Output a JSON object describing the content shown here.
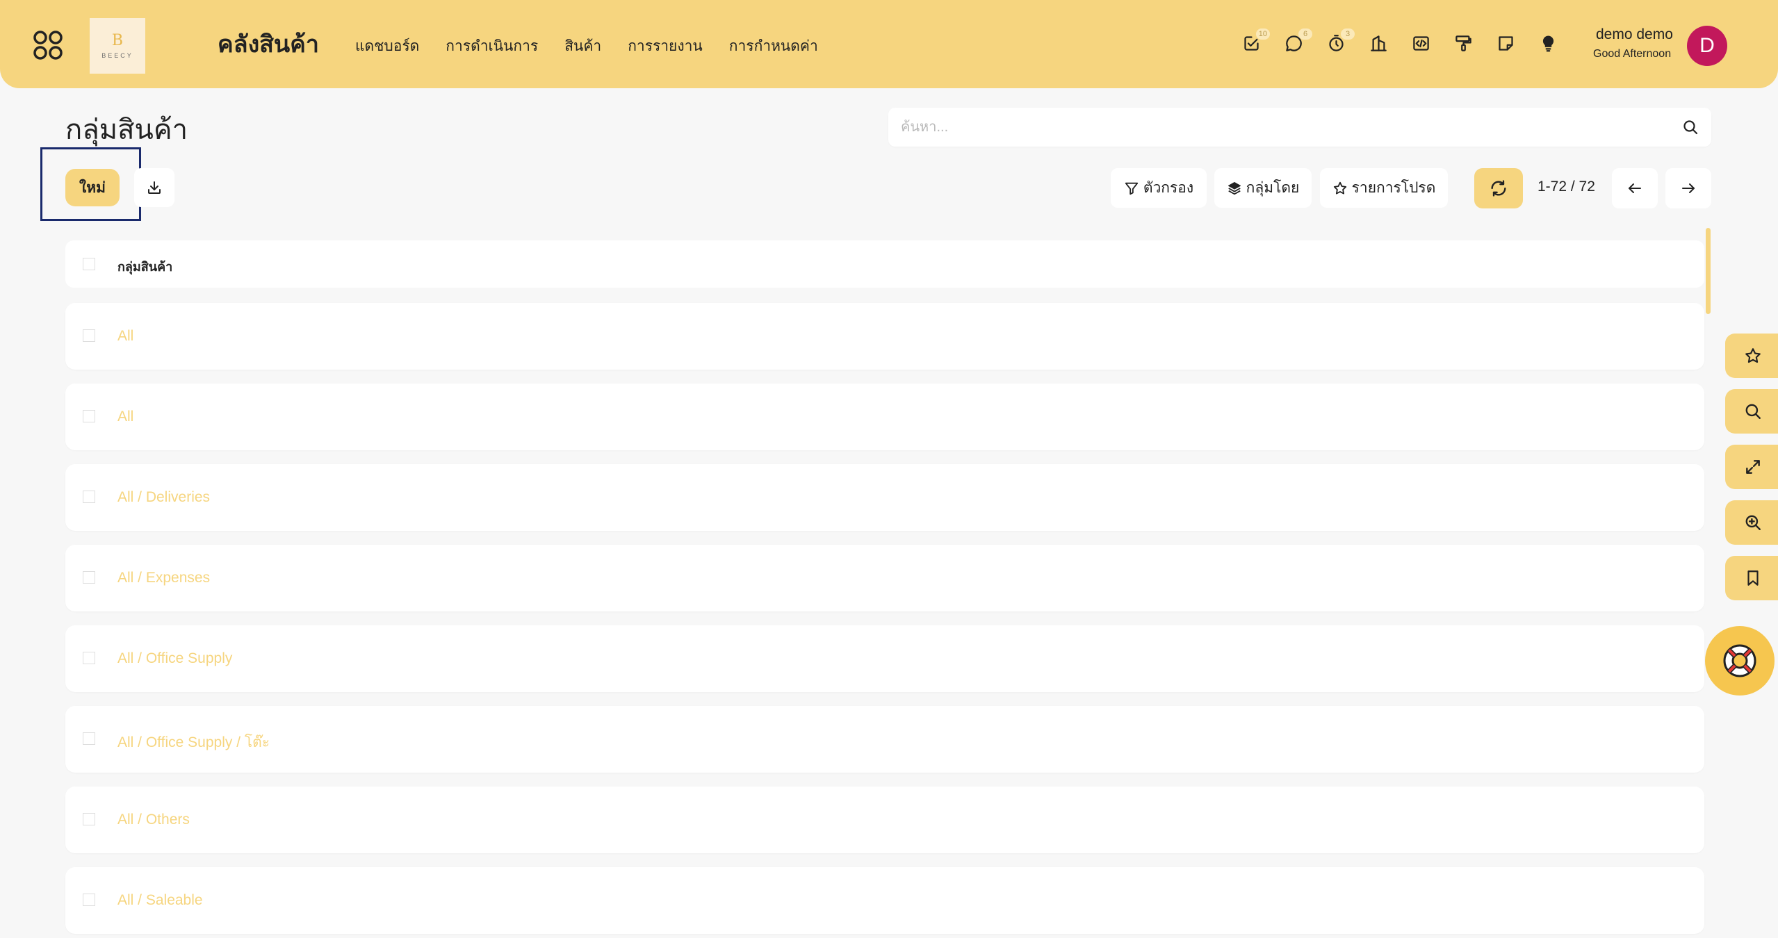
{
  "app": {
    "title": "คลังสินค้า",
    "logo_text": "BEECY",
    "logo_letter": "B"
  },
  "nav": {
    "items": [
      "แดชบอร์ด",
      "การดำเนินการ",
      "สินค้า",
      "การรายงาน",
      "การกำหนดค่า"
    ]
  },
  "top_icons": [
    {
      "icon": "activity-icon",
      "badge": "10"
    },
    {
      "icon": "chat-icon",
      "badge": "6"
    },
    {
      "icon": "timer-icon",
      "badge": "3"
    },
    {
      "icon": "building-icon",
      "badge": ""
    },
    {
      "icon": "code-icon",
      "badge": ""
    },
    {
      "icon": "paint-roller-icon",
      "badge": ""
    },
    {
      "icon": "note-icon",
      "badge": ""
    },
    {
      "icon": "lightbulb-icon",
      "badge": ""
    }
  ],
  "user": {
    "name": "demo demo",
    "greeting": "Good Afternoon",
    "initial": "D"
  },
  "page": {
    "title": "กลุ่มสินค้า"
  },
  "search": {
    "placeholder": "ค้นหา..."
  },
  "toolbar": {
    "new_label": "ใหม่",
    "filter_label": "ตัวกรอง",
    "group_by_label": "กลุ่มโดย",
    "favorites_label": "รายการโปรด",
    "pager": "1-72 / 72"
  },
  "list": {
    "header": "กลุ่มสินค้า",
    "rows": [
      "All",
      "All",
      "All / Deliveries",
      "All / Expenses",
      "All / Office Supply",
      "All / Office Supply / โต๊ะ",
      "All / Others",
      "All / Saleable"
    ]
  },
  "colors": {
    "accent": "#f6d57f",
    "avatar": "#c2185b",
    "highlight": "#1a2a6c"
  }
}
